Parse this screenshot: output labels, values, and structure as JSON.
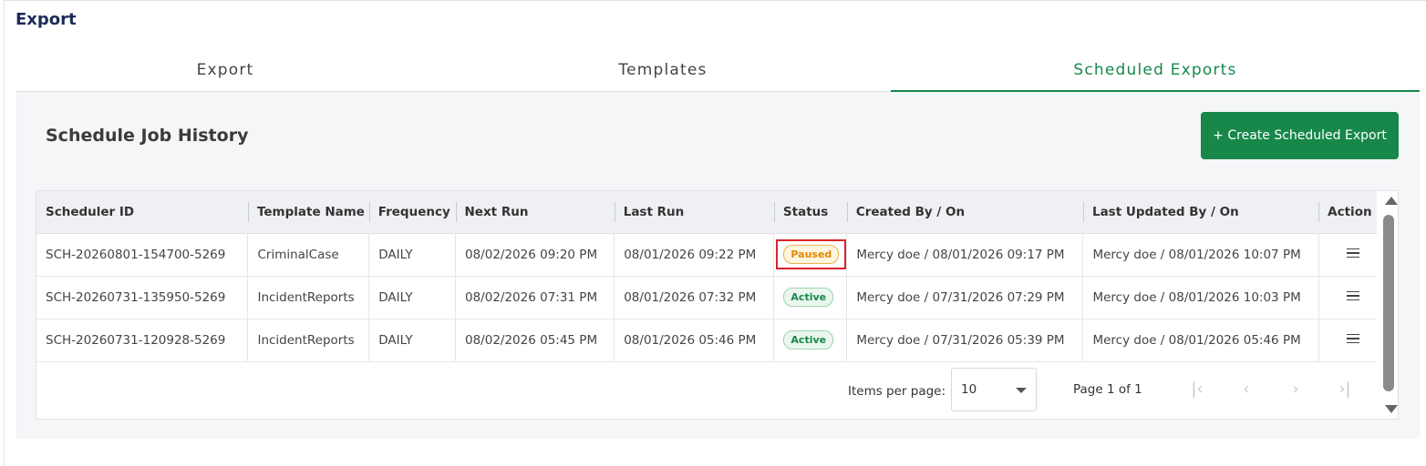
{
  "page": {
    "title": "Export"
  },
  "tabs": [
    {
      "label": "Export",
      "active": false
    },
    {
      "label": "Templates",
      "active": false
    },
    {
      "label": "Scheduled Exports",
      "active": true
    }
  ],
  "section": {
    "title": "Schedule Job History",
    "create_button_label": "+ Create Scheduled Export"
  },
  "table": {
    "columns": [
      "Scheduler ID",
      "Template Name",
      "Frequency",
      "Next Run",
      "Last Run",
      "Status",
      "Created By / On",
      "Last Updated By / On",
      "Action"
    ],
    "rows": [
      {
        "scheduler_id": "SCH-20260801-154700-5269",
        "template_name": "CriminalCase",
        "frequency": "DAILY",
        "next_run": "08/02/2026 09:20 PM",
        "last_run": "08/01/2026 09:22 PM",
        "status": "Paused",
        "created": "Mercy doe / 08/01/2026 09:17 PM",
        "updated": "Mercy doe / 08/01/2026 10:07 PM"
      },
      {
        "scheduler_id": "SCH-20260731-135950-5269",
        "template_name": "IncidentReports",
        "frequency": "DAILY",
        "next_run": "08/02/2026 07:31 PM",
        "last_run": "08/01/2026 07:32 PM",
        "status": "Active",
        "created": "Mercy doe / 07/31/2026 07:29 PM",
        "updated": "Mercy doe / 08/01/2026 10:03 PM"
      },
      {
        "scheduler_id": "SCH-20260731-120928-5269",
        "template_name": "IncidentReports",
        "frequency": "DAILY",
        "next_run": "08/02/2026 05:45 PM",
        "last_run": "08/01/2026 05:46 PM",
        "status": "Active",
        "created": "Mercy doe / 07/31/2026 05:39 PM",
        "updated": "Mercy doe / 08/01/2026 05:46 PM"
      }
    ]
  },
  "pagination": {
    "items_per_page_label": "Items per page:",
    "items_per_page_value": "10",
    "page_info": "Page 1 of 1",
    "first_icon": "first-page-icon",
    "prev_icon": "chevron-left-icon",
    "next_icon": "chevron-right-icon",
    "last_icon": "last-page-icon"
  },
  "colors": {
    "accent": "#17884a",
    "title": "#1d2a57",
    "paused": "#e08a00",
    "highlight_border": "#d8252b"
  }
}
